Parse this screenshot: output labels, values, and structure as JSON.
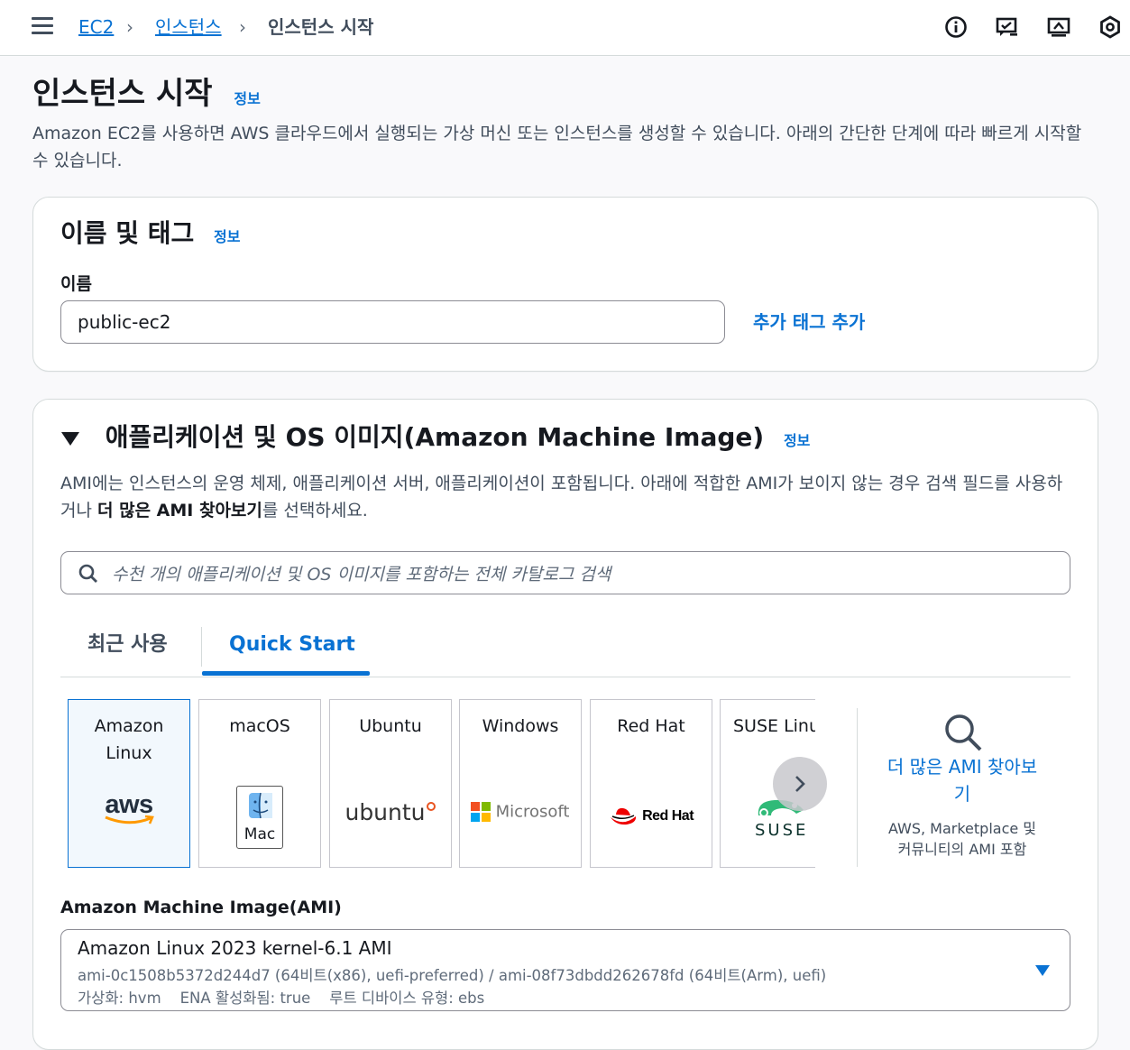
{
  "header": {
    "breadcrumb": [
      "EC2",
      "인스턴스",
      "인스턴스 시작"
    ],
    "icons": [
      "info-icon",
      "feedback-icon",
      "screen-icon",
      "settings-icon"
    ]
  },
  "page": {
    "title": "인스턴스 시작",
    "info": "정보",
    "description": "Amazon EC2를 사용하면 AWS 클라우드에서 실행되는 가상 머신 또는 인스턴스를 생성할 수 있습니다. 아래의 간단한 단계에 따라 빠르게 시작할 수 있습니다."
  },
  "name_tags": {
    "title": "이름 및 태그",
    "info": "정보",
    "name_label": "이름",
    "name_value": "public-ec2",
    "add_tags": "추가 태그 추가"
  },
  "ami_section": {
    "title": "애플리케이션 및 OS 이미지(Amazon Machine Image)",
    "info": "정보",
    "desc_part1": "AMI에는 인스턴스의 운영 체제, 애플리케이션 서버, 애플리케이션이 포함됩니다. 아래에 적합한 AMI가 보이지 않는 경우 검색 필드를 사용하거나 ",
    "desc_bold": "더 많은 AMI 찾아보기",
    "desc_part2": "를 선택하세요.",
    "search_placeholder": "수천 개의 애플리케이션 및 OS 이미지를 포함하는 전체 카탈로그 검색",
    "tabs": [
      "최근 사용",
      "Quick Start"
    ],
    "active_tab": "Quick Start",
    "os_tiles": [
      {
        "line1": "Amazon",
        "line2": "Linux",
        "logo": "aws"
      },
      {
        "line1": "macOS",
        "line2": "",
        "logo": "Mac"
      },
      {
        "line1": "Ubuntu",
        "line2": "",
        "logo": "ubuntu"
      },
      {
        "line1": "Windows",
        "line2": "",
        "logo": "Microsoft"
      },
      {
        "line1": "Red Hat",
        "line2": "",
        "logo": "Red Hat"
      },
      {
        "line1": "SUSE Linu",
        "line2": "",
        "logo": "SUSE"
      }
    ],
    "selected_tile": "Amazon Linux",
    "browse_more": "더 많은 AMI 찾아보기",
    "browse_more_sub": "AWS, Marketplace 및 커뮤니티의 AMI 포함",
    "ami_label": "Amazon Machine Image(AMI)",
    "ami_selected_name": "Amazon Linux 2023 kernel-6.1 AMI",
    "ami_selected_ids": "ami-0c1508b5372d244d7 (64비트(x86), uefi-preferred) / ami-08f73dbdd262678fd (64비트(Arm), uefi)",
    "ami_virtualization": "가상화: hvm",
    "ami_ena": "ENA 활성화됨: true",
    "ami_root_device": "루트 디바이스 유형: ebs"
  },
  "colors": {
    "link": "#0972d3",
    "text": "#16191f",
    "secondary_text": "#414d5c",
    "border": "#d5dbdb"
  }
}
